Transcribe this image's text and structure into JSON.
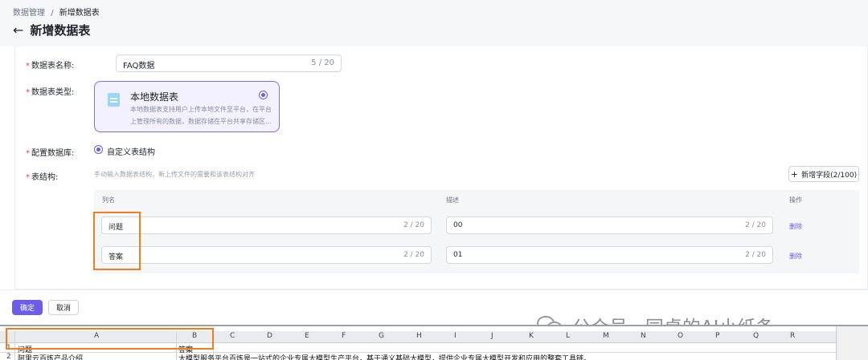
{
  "breadcrumb": {
    "parent": "数据管理",
    "separator": "/",
    "current": "新增数据表"
  },
  "page_title": "新增数据表",
  "form": {
    "name_label": "数据表名称:",
    "name_value": "FAQ数据",
    "name_count": "5 / 20",
    "type_label": "数据表类型:",
    "type_title": "本地数据表",
    "type_desc": "本地数据表支持用户上传本地文件至平台，在平台上管理所有的数据，数据存储在平台共享存储区...",
    "db_label": "配置数据库:",
    "db_option": "自定义表结构",
    "schema_label": "表结构:",
    "schema_hint": "手动输入数据表结构，新上传文件的需要和该表结构对齐",
    "add_field": "新增字段(2/100)"
  },
  "table": {
    "col_name": "列名",
    "col_desc": "描述",
    "col_action": "操作",
    "rows": [
      {
        "name": "问题",
        "name_count": "2 / 20",
        "desc": "00",
        "desc_count": "2 / 20",
        "action": "删除"
      },
      {
        "name": "答案",
        "name_count": "2 / 20",
        "desc": "01",
        "desc_count": "2 / 20",
        "action": "删除"
      }
    ]
  },
  "footer": {
    "ok": "确定",
    "cancel": "取消"
  },
  "watermark": "公众号 · 同桌的AI小纸条",
  "spreadsheet": {
    "columns": [
      "A",
      "B",
      "C",
      "D",
      "E",
      "F",
      "G",
      "H",
      "I",
      "J",
      "K",
      "L",
      "M",
      "N",
      "O",
      "P",
      "Q",
      "R"
    ],
    "rows": [
      {
        "num": "1",
        "a": "问题",
        "b": "答案"
      },
      {
        "num": "2",
        "a": "阿里云百炼产品介绍",
        "b": "大模型服务平台百炼是一站式的企业专属大模型生产平台，基于通义基础大模型，提供企业专属大模型开发和应用的整套工具链。"
      }
    ]
  },
  "colors": {
    "accent": "#6c5ce7",
    "highlight": "#f27d1e",
    "required": "#e5484d"
  }
}
